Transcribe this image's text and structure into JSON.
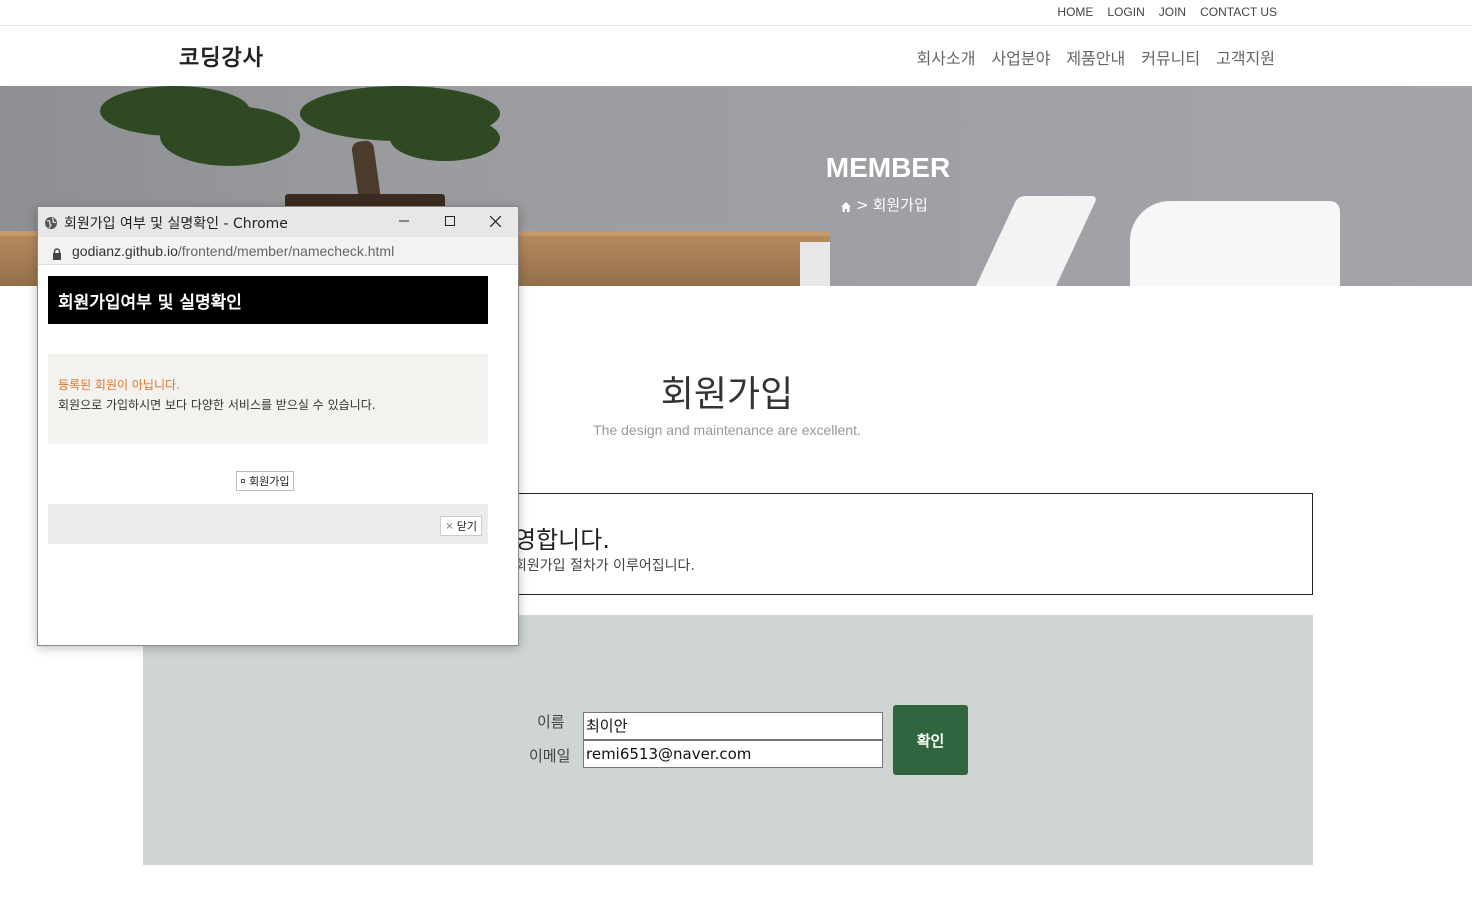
{
  "util_nav": [
    "HOME",
    "LOGIN",
    "JOIN",
    "CONTACT US"
  ],
  "logo": "코딩강사",
  "gnb": [
    "회사소개",
    "사업분야",
    "제품안내",
    "커뮤니티",
    "고객지원"
  ],
  "hero": {
    "title": "MEMBER",
    "breadcrumb_sep": ">",
    "breadcrumb_current": "회원가입"
  },
  "section": {
    "title": "회원가입",
    "subtitle": "The design and maintenance are excellent."
  },
  "welcome": {
    "title_visible": "영합니다.",
    "desc_visible": "회원가입 절차가 이루어집니다."
  },
  "form": {
    "name_label": "이름",
    "name_value": "최이안",
    "email_label": "이메일",
    "email_value": "remi6513@naver.com",
    "confirm_label": "확인"
  },
  "popup": {
    "window_title": "회원가입 여부 및 실명확인 - Chrome",
    "url_host": "godianz.github.io",
    "url_path": "/frontend/member/namecheck.html",
    "heading": "회원가입여부 및 실명확인",
    "msg_alert": "등록된 회원이 아닙니다.",
    "msg_info": "회원으로 가입하시면 보다 다양한 서비스를 받으실 수 있습니다.",
    "join_label": "회원가입",
    "close_label": "닫기"
  },
  "colors": {
    "confirm_bg": "#31653f",
    "form_bg": "#ced5d2",
    "alert_text": "#e0742b",
    "popup_head_bg": "#000000"
  },
  "icons": [
    "home-icon",
    "globe-icon",
    "lock-icon",
    "minimize-icon",
    "maximize-icon",
    "close-icon"
  ]
}
